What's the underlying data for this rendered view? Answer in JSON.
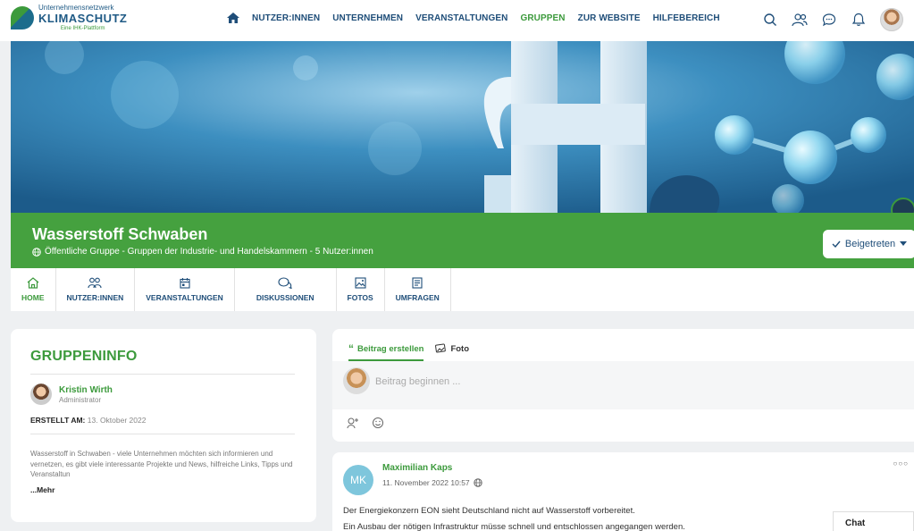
{
  "logo": {
    "line1": "Unternehmensnetzwerk",
    "line2": "KLIMASCHUTZ",
    "line3": "Eine IHK-Plattform"
  },
  "nav": {
    "items": [
      "NUTZER:INNEN",
      "UNTERNEHMEN",
      "VERANSTALTUNGEN",
      "GRUPPEN",
      "ZUR WEBSITE",
      "HILFEBEREICH"
    ],
    "active": "GRUPPEN"
  },
  "header_icons": [
    "search-icon",
    "users-icon",
    "chat-icon",
    "bell-icon",
    "user-avatar"
  ],
  "group": {
    "title": "Wasserstoff Schwaben",
    "subtitle": "Öffentliche Gruppe - Gruppen der Industrie- und Handelskammern - 5 Nutzer:innen",
    "joined_label": "Beigetreten"
  },
  "tabs": [
    {
      "label": "HOME",
      "icon": "home-icon"
    },
    {
      "label": "NUTZER:INNEN",
      "icon": "users-icon"
    },
    {
      "label": "VERANSTALTUNGEN",
      "icon": "calendar-icon"
    },
    {
      "label": "DISKUSSIONEN",
      "icon": "discussion-icon"
    },
    {
      "label": "FOTOS",
      "icon": "photo-icon"
    },
    {
      "label": "UMFRAGEN",
      "icon": "poll-icon"
    }
  ],
  "active_tab": "HOME",
  "info": {
    "title": "GRUPPENINFO",
    "admin_name": "Kristin Wirth",
    "admin_role": "Administrator",
    "created_label": "ERSTELLT AM:",
    "created_value": "13. Oktober 2022",
    "description": "Wasserstoff in Schwaben - viele Unternehmen möchten sich informieren und vernetzen, es gibt viele interessante Projekte und News, hilfreiche Links, Tipps und Veranstaltun",
    "more_label": "...Mehr"
  },
  "composer": {
    "tab_post": "Beitrag erstellen",
    "tab_photo": "Foto",
    "placeholder": "Beitrag beginnen ..."
  },
  "post": {
    "avatar_initials": "MK",
    "author": "Maximilian Kaps",
    "date": "11. November 2022 10:57",
    "line1": "Der Energiekonzern EON sieht Deutschland nicht auf Wasserstoff vorbereitet.",
    "line2": "Ein Ausbau der nötigen Infrastruktur müsse schnell und entschlossen angegangen werden."
  },
  "chat": {
    "label": "Chat"
  },
  "colors": {
    "accent_green": "#45a13f",
    "navy": "#1f4e79",
    "cover_blue": "#2f79a9"
  }
}
